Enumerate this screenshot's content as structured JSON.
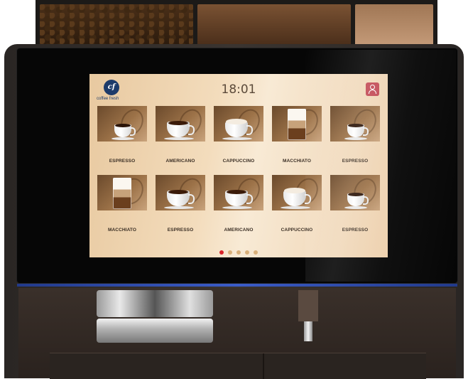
{
  "screen": {
    "brand": {
      "logo_text": "cf",
      "name": "coffee fresh"
    },
    "clock": "18:01",
    "user_icon": "user-icon",
    "colors": {
      "accent": "#d8232a",
      "user_button": "#c24a55",
      "brand": "#1d3b6a"
    },
    "drinks": [
      {
        "label": "ESPRESSO",
        "cup": "small"
      },
      {
        "label": "AMERICANO",
        "cup": "wide"
      },
      {
        "label": "CAPPUCCINO",
        "cup": "foam"
      },
      {
        "label": "MACCHIATO",
        "cup": "glass"
      },
      {
        "label": "ESPRESSO",
        "cup": "small"
      },
      {
        "label": "MACCHIATO",
        "cup": "glass"
      },
      {
        "label": "ESPRESSO",
        "cup": "wide"
      },
      {
        "label": "AMERICANO",
        "cup": "wide"
      },
      {
        "label": "CAPPUCCINO",
        "cup": "foam"
      },
      {
        "label": "ESPRESSO",
        "cup": "small"
      }
    ],
    "pagination": {
      "pages": 5,
      "current": 1
    }
  }
}
